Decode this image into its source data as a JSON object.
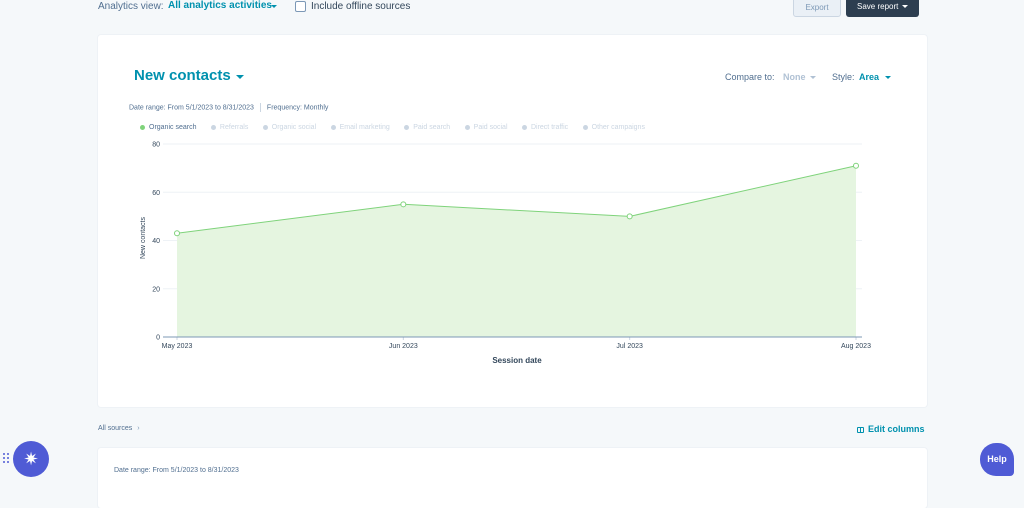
{
  "topbar": {
    "analytics_view_label": "Analytics view:",
    "analytics_view_value": "All analytics activities",
    "offline_checkbox_label": "Include offline sources",
    "offline_checked": false,
    "export_label": "Export",
    "save_report_label": "Save report"
  },
  "report": {
    "title": "New contacts",
    "compare_label": "Compare to:",
    "compare_value": "None",
    "style_label": "Style:",
    "style_value": "Area",
    "date_range": "Date range: From 5/1/2023 to 8/31/2023",
    "frequency": "Frequency: Monthly",
    "legend": [
      {
        "label": "Organic search",
        "active": true
      },
      {
        "label": "Referrals",
        "active": false
      },
      {
        "label": "Organic social",
        "active": false
      },
      {
        "label": "Email marketing",
        "active": false
      },
      {
        "label": "Paid search",
        "active": false
      },
      {
        "label": "Paid social",
        "active": false
      },
      {
        "label": "Direct traffic",
        "active": false
      },
      {
        "label": "Other campaigns",
        "active": false
      }
    ]
  },
  "chart_data": {
    "type": "area",
    "categories": [
      "May 2023",
      "Jun 2023",
      "Jul 2023",
      "Aug 2023"
    ],
    "series": [
      {
        "name": "Organic search",
        "values": [
          43,
          55,
          50,
          71
        ]
      }
    ],
    "xlabel": "Session date",
    "ylabel": "New contacts",
    "ylim": [
      0,
      80
    ],
    "yticks": [
      0,
      20,
      40,
      60,
      80
    ],
    "grid": true,
    "legend_position": "top-left",
    "colors": {
      "fill": "#e5f5e0",
      "line": "#7fd37b"
    }
  },
  "footer": {
    "all_sources_label": "All sources",
    "edit_columns_label": "Edit columns",
    "table_date_range": "Date range: From 5/1/2023 to 8/31/2023"
  },
  "widgets": {
    "help_label": "Help"
  },
  "colors": {
    "accent": "#0091ae",
    "dark_button": "#2d3e50",
    "launcher": "#4f5bd5"
  }
}
